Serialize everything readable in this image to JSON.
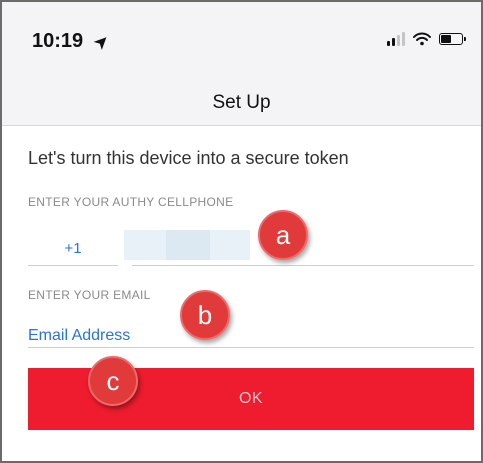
{
  "status_bar": {
    "time": "10:19",
    "location_icon": "location-arrow-icon",
    "signal_icon": "cellular-signal-icon",
    "wifi_icon": "wifi-icon",
    "battery_icon": "battery-icon"
  },
  "nav": {
    "title": "Set Up"
  },
  "form": {
    "tagline": "Let's turn this device into a secure token",
    "phone_label": "ENTER YOUR AUTHY CELLPHONE",
    "country_code": "+1",
    "email_label": "ENTER YOUR EMAIL",
    "email_placeholder": "Email Address",
    "ok_label": "OK"
  },
  "annotations": {
    "a": "a",
    "b": "b",
    "c": "c"
  },
  "colors": {
    "accent_blue": "#2a74d5",
    "button_red": "#ee1c2e",
    "callout_red": "#e03a3a"
  }
}
